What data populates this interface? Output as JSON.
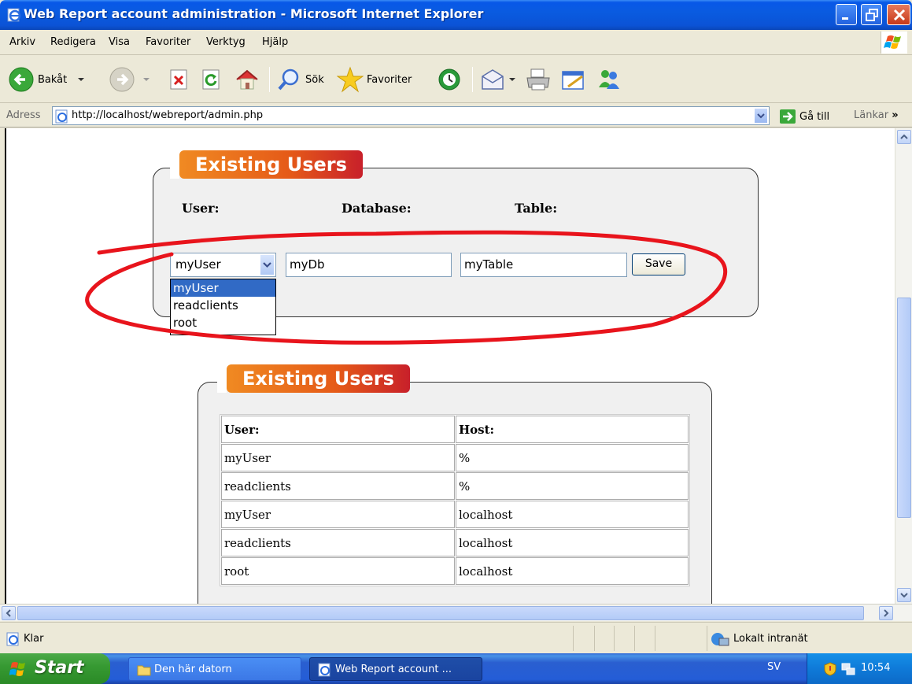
{
  "window": {
    "title": "Web Report account administration - Microsoft Internet Explorer"
  },
  "menu": [
    "Arkiv",
    "Redigera",
    "Visa",
    "Favoriter",
    "Verktyg",
    "Hjälp"
  ],
  "toolbar": {
    "back_label": "Bakåt",
    "search_label": "Sök",
    "favorites_label": "Favoriter"
  },
  "address": {
    "label": "Adress",
    "url": "http://localhost/webreport/admin.php",
    "go_label": "Gå till",
    "links_label": "Länkar"
  },
  "panel1": {
    "legend": "Existing Users",
    "col_user": "User:",
    "col_database": "Database:",
    "col_table": "Table:",
    "user_select_value": "myUser",
    "database_value": "myDb",
    "table_value": "myTable",
    "save_label": "Save",
    "user_options": [
      "myUser",
      "readclients",
      "root"
    ]
  },
  "panel2": {
    "legend": "Existing Users",
    "headers": [
      "User:",
      "Host:"
    ],
    "rows": [
      [
        "myUser",
        "%"
      ],
      [
        "readclients",
        "%"
      ],
      [
        "myUser",
        "localhost"
      ],
      [
        "readclients",
        "localhost"
      ],
      [
        "root",
        "localhost"
      ]
    ]
  },
  "status": {
    "text": "Klar",
    "zone": "Lokalt intranät"
  },
  "taskbar": {
    "start_label": "Start",
    "items": [
      "Den här datorn",
      "Web Report account ..."
    ],
    "language": "SV",
    "clock": "10:54"
  },
  "colors": {
    "annotation_circle": "#e8141c",
    "legend_orange": "#f08a22",
    "legend_red": "#c8202a",
    "selection_blue": "#316ac5"
  }
}
